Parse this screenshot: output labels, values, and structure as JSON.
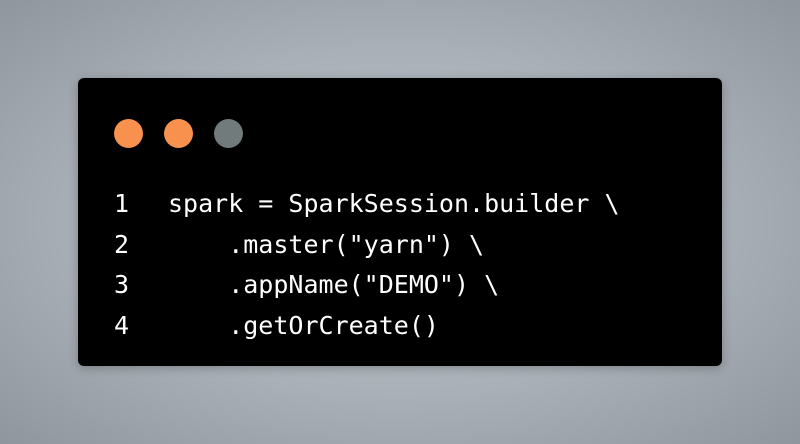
{
  "window": {
    "controls": [
      {
        "name": "close-dot",
        "color": "#f7914d"
      },
      {
        "name": "minimize-dot",
        "color": "#f7914d"
      },
      {
        "name": "maximize-dot",
        "color": "#717b7b"
      }
    ]
  },
  "code": {
    "lines": [
      {
        "number": "1",
        "text": "spark = SparkSession.builder \\"
      },
      {
        "number": "2",
        "text": "    .master(\"yarn\") \\"
      },
      {
        "number": "3",
        "text": "    .appName(\"DEMO\") \\"
      },
      {
        "number": "4",
        "text": "    .getOrCreate()"
      }
    ]
  }
}
